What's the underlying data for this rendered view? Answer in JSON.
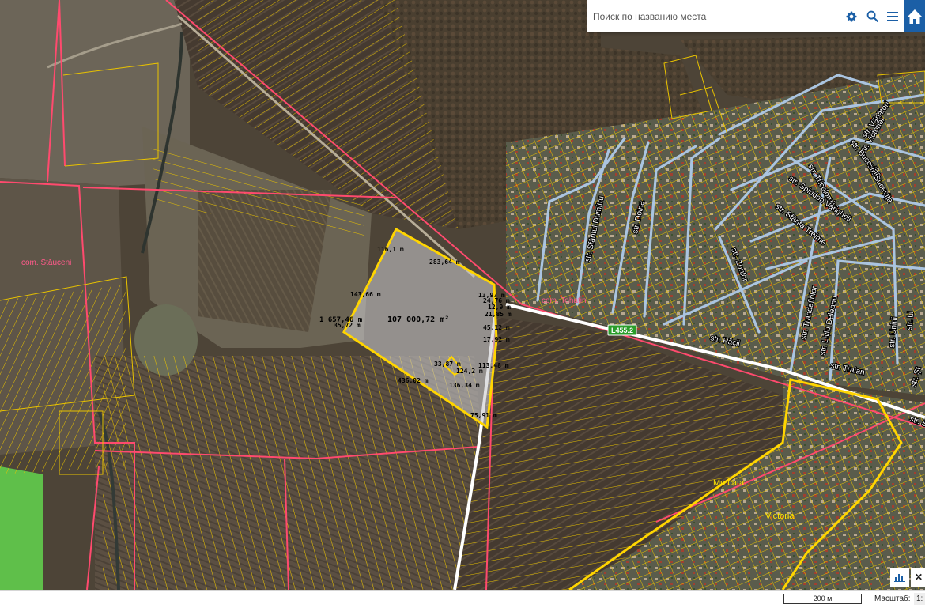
{
  "search": {
    "placeholder": "Поиск по названию места"
  },
  "toolbar": {
    "settings_icon": "gear-icon",
    "search_icon": "search-icon",
    "menu_icon": "hamburger-menu-icon",
    "home_icon": "home-icon"
  },
  "colors": {
    "commune_border": "#ff4a6e",
    "parcel_border": "#e8c200",
    "street_line": "#aac4e0",
    "highlight": "#ffd500",
    "road_badge": "#2a9d2a"
  },
  "map": {
    "communes": [
      "com. Stăuceni",
      "com. Tohatin"
    ],
    "villages": [
      "Mu cata",
      "Victoria"
    ],
    "road_badge": "L455.2",
    "area_label": "107 000,72 m²",
    "measurements": [
      "116,1 m",
      "283,64 m",
      "143,66 m",
      "1 657,46 m",
      "35,72 m",
      "13,97 m",
      "24,76 m",
      "12,9 m",
      "21,85 m",
      "45,12 m",
      "17,92 m",
      "33,87 m",
      "113,48 m",
      "124,2 m",
      "436,02 m",
      "136,34 m",
      "75,91 m"
    ],
    "streets": [
      "str. Vănători",
      "str. Victoriei",
      "str. Bucovina",
      "str. Sucevița",
      "str. Tricolorului",
      "str. Spiridon Vangheli",
      "str. Sfânta Treime",
      "str. Sfântul Dumitru",
      "str. Doina",
      "str. Zorilor",
      "str. Trandafirilor",
      "str. Liviu Deleanu",
      "str. Unirii",
      "str. Păcii",
      "str. Traian",
      "str. Li",
      "str. Șt",
      "str. Stefan"
    ]
  },
  "footer": {
    "scale_bar_label": "200 м",
    "scale_label": "Масштаб:",
    "scale_value": "1:"
  }
}
